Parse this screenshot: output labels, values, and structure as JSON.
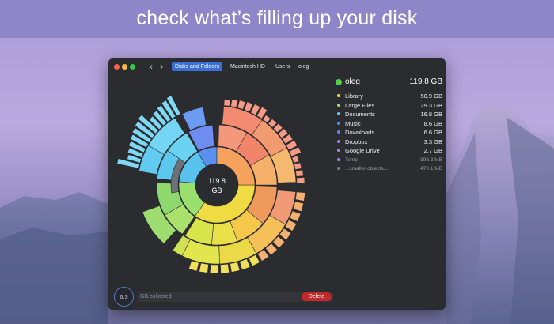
{
  "banner": {
    "headline": "check what’s filling up your disk"
  },
  "window": {
    "nav": {
      "back_icon": "chevron-left-icon",
      "forward_icon": "chevron-right-icon"
    },
    "breadcrumb": [
      {
        "label": "Disks and Folders",
        "active": true
      },
      {
        "label": "Macintosh HD",
        "active": false
      },
      {
        "label": "Users",
        "active": false
      },
      {
        "label": "oleg",
        "active": false
      }
    ],
    "chart": {
      "center_value": "119.8",
      "center_unit": "GB"
    },
    "root": {
      "name": "oleg",
      "size": "119.8 GB",
      "color": "#4fd04a"
    },
    "items": [
      {
        "name": "Library",
        "size": "50.9 GB",
        "color": "#f2d93b"
      },
      {
        "name": "Large Files",
        "size": "29.3 GB",
        "color": "#8ee37a"
      },
      {
        "name": "Documents",
        "size": "16.8 GB",
        "color": "#5fc9f2"
      },
      {
        "name": "Music",
        "size": "8.6 GB",
        "color": "#4f8ff0"
      },
      {
        "name": "Downloads",
        "size": "6.6 GB",
        "color": "#6f7ff2"
      },
      {
        "name": "Dropbox",
        "size": "3.3 GB",
        "color": "#9a7cf0"
      },
      {
        "name": "Google Drive",
        "size": "2.7 GB",
        "color": "#b07cf2"
      },
      {
        "name": "Temp",
        "size": "998.3 MB",
        "color": "#b07cf2",
        "small": true
      },
      {
        "name": "...smaller objects...",
        "size": "470.1 MB",
        "color": "#777a82",
        "small": true
      }
    ],
    "bottom": {
      "collected_value": "6.3",
      "collected_label": "GB collected",
      "delete_label": "Delete"
    }
  }
}
